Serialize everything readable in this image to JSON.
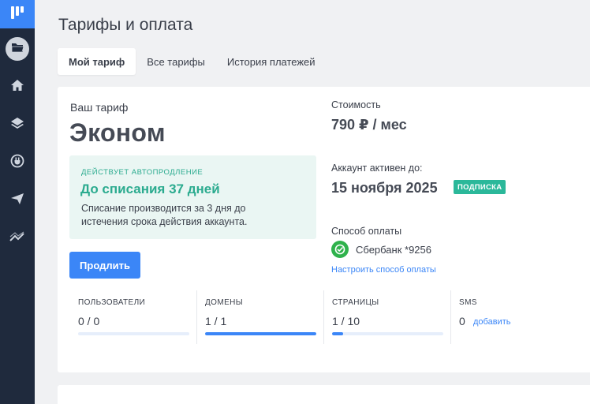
{
  "sidebar": {
    "items": [
      {
        "icon": "logo-icon"
      },
      {
        "icon": "folder-icon"
      },
      {
        "icon": "home-icon"
      },
      {
        "icon": "layers-icon"
      },
      {
        "icon": "plug-icon"
      },
      {
        "icon": "send-icon"
      },
      {
        "icon": "trend-icon"
      }
    ]
  },
  "header": {
    "title": "Тарифы и оплата"
  },
  "tabs": [
    {
      "label": "Мой тариф",
      "active": true
    },
    {
      "label": "Все тарифы",
      "active": false
    },
    {
      "label": "История платежей",
      "active": false
    }
  ],
  "plan": {
    "label": "Ваш тариф",
    "name": "Эконом",
    "renew_caption": "ДЕЙСТВУЕТ АВТОПРОДЛЕНИЕ",
    "renew_title": "До списания 37 дней",
    "renew_desc": "Списание производится за 3 дня до истечения срока действия аккаунта.",
    "extend_label": "Продлить"
  },
  "billing": {
    "cost_label": "Стоимость",
    "cost_value": "790 ₽ / мес",
    "active_label": "Аккаунт активен до:",
    "active_date": "15 ноября 2025",
    "subscription_badge": "ПОДПИСКА",
    "payment_label": "Способ оплаты",
    "payment_method": "Сбербанк *9256",
    "payment_link": "Настроить способ оплаты"
  },
  "stats": [
    {
      "label": "ПОЛЬЗОВАТЕЛИ",
      "value": "0 / 0",
      "progress": 0
    },
    {
      "label": "ДОМЕНЫ",
      "value": "1 / 1",
      "progress": 1.0
    },
    {
      "label": "СТРАНИЦЫ",
      "value": "1 / 10",
      "progress": 0.1
    },
    {
      "label": "SMS",
      "value": "0",
      "add_label": "добавить"
    }
  ],
  "colors": {
    "accent": "#3b86f7",
    "sidebar_bg": "#1f2a3d",
    "success": "#2bab8f",
    "success_bg": "#eaf6f3",
    "badge": "#2bb89a",
    "sber": "#2fb24c"
  }
}
